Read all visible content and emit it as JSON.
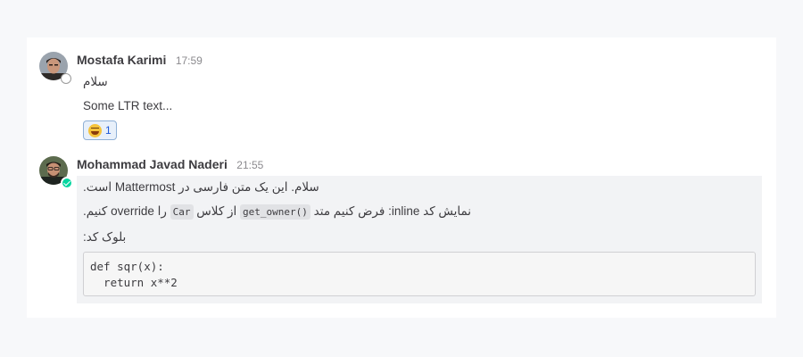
{
  "posts": [
    {
      "author": "Mostafa Karimi",
      "time": "17:59",
      "status": "offline",
      "messages": [
        "سلام",
        "Some LTR text..."
      ],
      "reaction": {
        "emoji": "joy-emoji",
        "count": "1"
      }
    },
    {
      "author": "Mohammad Javad Naderi",
      "time": "21:55",
      "status": "online",
      "line1": "سلام. این یک متن فارسی در Mattermost است.",
      "line2": {
        "p1": "نمایش کد inline: فرض کنیم متد",
        "code1": "get_owner()",
        "p2": "از کلاس",
        "code2": "Car",
        "p3": "را override کنیم."
      },
      "line3": "بلوک کد:",
      "code_block": "def sqr(x):\n  return x**2"
    }
  ],
  "colors": {
    "page_background": "#f7f8fa",
    "channel_background": "#ffffff",
    "highlight_background": "#f2f3f5",
    "online_status": "#06d6a0",
    "reaction_border": "#8fb0d6"
  }
}
